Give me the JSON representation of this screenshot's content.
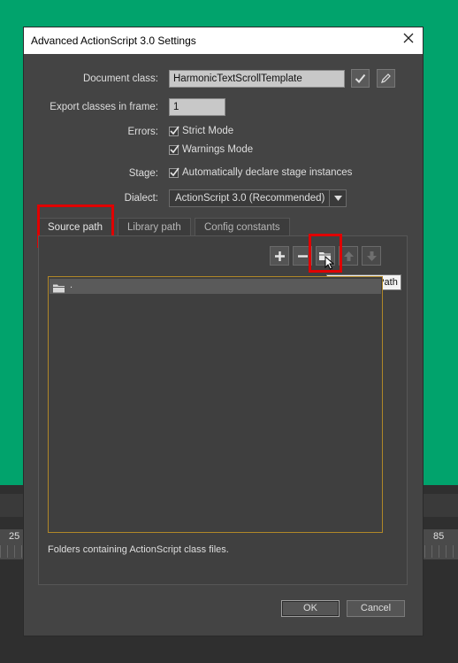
{
  "background": {
    "ruler_left": "25",
    "ruler_right": "85"
  },
  "dialog": {
    "title": "Advanced ActionScript 3.0 Settings",
    "document_class": {
      "label": "Document class:",
      "value": "HarmonicTextScrollTemplate"
    },
    "export_frame": {
      "label": "Export classes in frame:",
      "value": "1"
    },
    "errors": {
      "label": "Errors:",
      "strict_mode": {
        "label": "Strict Mode",
        "checked": true
      },
      "warnings_mode": {
        "label": "Warnings Mode",
        "checked": true
      }
    },
    "stage": {
      "label": "Stage:",
      "auto_declare": {
        "label": "Automatically declare stage instances",
        "checked": true
      }
    },
    "dialect": {
      "label": "Dialect:",
      "value": "ActionScript 3.0 (Recommended)"
    },
    "tabs": [
      {
        "label": "Source path",
        "active": true
      },
      {
        "label": "Library path",
        "active": false
      },
      {
        "label": "Config constants",
        "active": false
      }
    ],
    "tooltip": "Browse To Path",
    "source_paths": [
      "."
    ],
    "description": "Folders containing ActionScript class files.",
    "ok_label": "OK",
    "cancel_label": "Cancel"
  },
  "colors": {
    "background_green": "#01a36c",
    "dialog_bg": "#444444",
    "highlight": "#e00000",
    "list_border": "#b08728"
  },
  "icons": [
    "close-icon",
    "check-icon",
    "pencil-icon",
    "plus-icon",
    "minus-icon",
    "folder-icon",
    "arrow-up-icon",
    "arrow-down-icon",
    "chevron-down-icon",
    "cursor-icon"
  ]
}
